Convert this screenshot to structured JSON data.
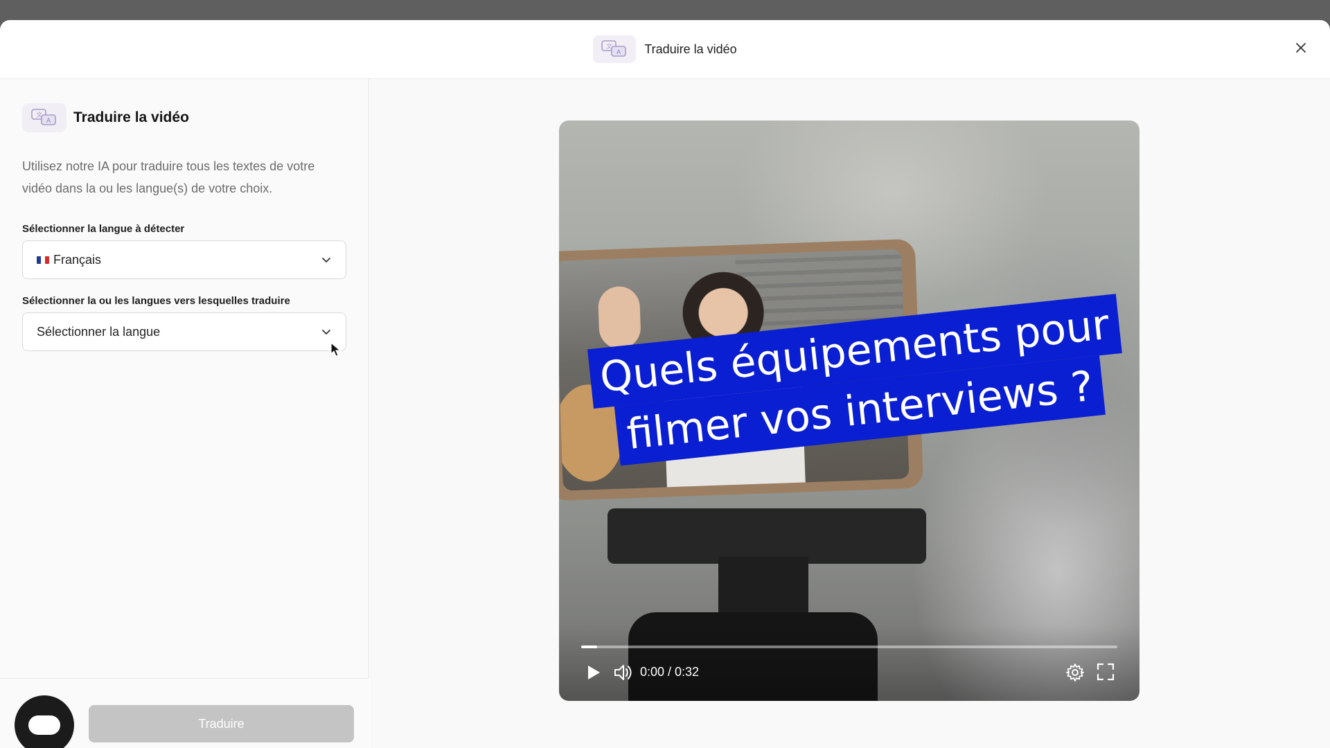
{
  "header": {
    "title": "Traduire la vidéo",
    "icon": "translate-ai-icon",
    "close_icon": "close-icon"
  },
  "sidebar": {
    "title": "Traduire la vidéo",
    "description": "Utilisez notre IA pour traduire tous les textes de votre vidéo dans la ou les langue(s) de votre choix.",
    "detect_label": "Sélectionner la langue à détecter",
    "detect_value": "Français",
    "target_label": "Sélectionner la ou les langues vers lesquelles traduire",
    "target_placeholder": "Sélectionner la langue",
    "translate_button": "Traduire"
  },
  "video": {
    "caption_line1": "Quels équipements pour",
    "caption_line2": "filmer vos interviews ?",
    "time": "0:00 / 0:32",
    "progress_fraction": 0.03
  },
  "colors": {
    "caption_bg": "#0a1ed2",
    "button_disabled": "#c4c4c4",
    "chat_fab": "#1b1b1b",
    "accent_badge": "#f1eff5"
  }
}
